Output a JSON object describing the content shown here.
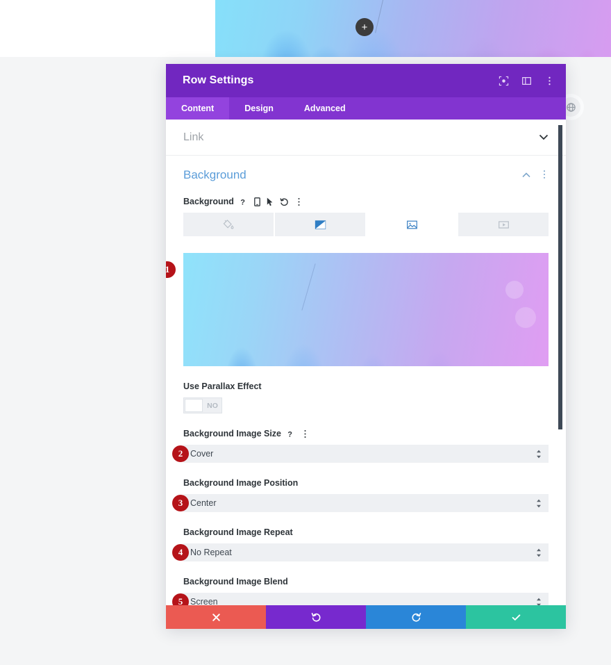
{
  "canvas": {
    "add_button_label": "+",
    "add_button_icon": "plus-icon"
  },
  "globe_button": {
    "icon": "globe-icon"
  },
  "modal": {
    "title": "Row Settings",
    "header_icons": [
      {
        "name": "focus-target-icon",
        "glyph": "⬚"
      },
      {
        "name": "layout-panel-icon",
        "glyph": "▣"
      },
      {
        "name": "more-vertical-icon",
        "glyph": "⋮"
      }
    ],
    "tabs": [
      {
        "label": "Content",
        "active": true
      },
      {
        "label": "Design",
        "active": false
      },
      {
        "label": "Advanced",
        "active": false
      }
    ],
    "sections": {
      "link": {
        "label": "Link",
        "chevron": "∨"
      },
      "background": {
        "title": "Background",
        "collapse_icon": "∧",
        "more_icon": "⋮",
        "field_label": "Background",
        "field_icons": [
          {
            "name": "help-icon",
            "glyph": "?"
          },
          {
            "name": "mobile-device-icon",
            "glyph": "▯"
          },
          {
            "name": "cursor-pointer-icon",
            "glyph": "➤"
          },
          {
            "name": "reset-undo-icon",
            "glyph": "↺"
          },
          {
            "name": "more-vertical-icon",
            "glyph": "⋮"
          }
        ],
        "bg_types": [
          {
            "name": "background-color-tab",
            "icon": "paint-bucket-icon",
            "active": false
          },
          {
            "name": "background-gradient-tab",
            "icon": "gradient-icon",
            "active": false
          },
          {
            "name": "background-image-tab",
            "icon": "image-icon",
            "active": true
          },
          {
            "name": "background-video-tab",
            "icon": "video-icon",
            "active": false
          }
        ],
        "preview_badge": "1",
        "parallax": {
          "label": "Use Parallax Effect",
          "value": "NO"
        },
        "fields": [
          {
            "badge": "2",
            "label": "Background Image Size",
            "value": "Cover",
            "has_help": true,
            "has_more": true
          },
          {
            "badge": "3",
            "label": "Background Image Position",
            "value": "Center",
            "has_help": false,
            "has_more": false
          },
          {
            "badge": "4",
            "label": "Background Image Repeat",
            "value": "No Repeat",
            "has_help": false,
            "has_more": false
          },
          {
            "badge": "5",
            "label": "Background Image Blend",
            "value": "Screen",
            "has_help": false,
            "has_more": false
          }
        ]
      }
    },
    "footer_actions": [
      {
        "name": "cancel-button",
        "glyph": "✖",
        "color": "#eb5a52"
      },
      {
        "name": "undo-button",
        "glyph": "↺",
        "color": "#7729ce"
      },
      {
        "name": "redo-button",
        "glyph": "↻",
        "color": "#2a86d8"
      },
      {
        "name": "save-button",
        "glyph": "✔",
        "color": "#2cc4a0"
      }
    ]
  },
  "colors": {
    "header_purple": "#7127c0",
    "tabbar_purple": "#8234d0",
    "tab_active_purple": "#9343de",
    "section_title_blue": "#5b9dd9",
    "badge_red": "#b51319"
  }
}
